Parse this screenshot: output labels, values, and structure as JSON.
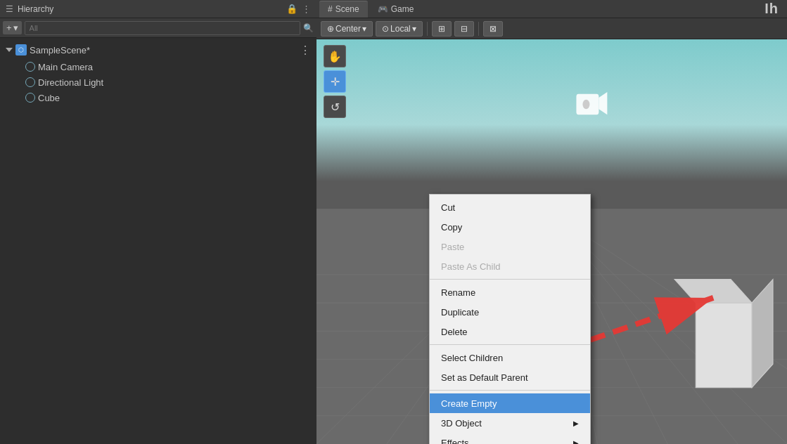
{
  "hierarchy": {
    "title": "Hierarchy",
    "lock_icon": "🔒",
    "menu_icon": "⋮",
    "add_button": "+",
    "add_dropdown": "▾",
    "search_placeholder": "All",
    "scene_name": "SampleScene*",
    "items": [
      {
        "label": "Main Camera",
        "icon": "obj"
      },
      {
        "label": "Directional Light",
        "icon": "obj"
      },
      {
        "label": "Cube",
        "icon": "obj"
      }
    ]
  },
  "tabs": [
    {
      "label": "Scene",
      "icon": "#",
      "active": true
    },
    {
      "label": "Game",
      "icon": "🎮",
      "active": false
    }
  ],
  "toolbar": {
    "center_label": "Center",
    "local_label": "Local",
    "btn1": "⊞",
    "btn2": "⊟",
    "btn3": "⊠"
  },
  "scene_tools": [
    {
      "label": "✋",
      "active": false,
      "name": "hand-tool"
    },
    {
      "label": "✛",
      "active": true,
      "name": "move-tool"
    },
    {
      "label": "↺",
      "active": false,
      "name": "rotate-tool"
    }
  ],
  "context_menu": {
    "items": [
      {
        "label": "Cut",
        "disabled": false,
        "has_arrow": false,
        "highlighted": false
      },
      {
        "label": "Copy",
        "disabled": false,
        "has_arrow": false,
        "highlighted": false
      },
      {
        "label": "Paste",
        "disabled": true,
        "has_arrow": false,
        "highlighted": false
      },
      {
        "label": "Paste As Child",
        "disabled": true,
        "has_arrow": false,
        "highlighted": false
      },
      {
        "separator": true
      },
      {
        "label": "Rename",
        "disabled": false,
        "has_arrow": false,
        "highlighted": false
      },
      {
        "label": "Duplicate",
        "disabled": false,
        "has_arrow": false,
        "highlighted": false
      },
      {
        "label": "Delete",
        "disabled": false,
        "has_arrow": false,
        "highlighted": false
      },
      {
        "separator": true
      },
      {
        "label": "Select Children",
        "disabled": false,
        "has_arrow": false,
        "highlighted": false
      },
      {
        "label": "Set as Default Parent",
        "disabled": false,
        "has_arrow": false,
        "highlighted": false
      },
      {
        "separator": true
      },
      {
        "label": "Create Empty",
        "disabled": false,
        "has_arrow": false,
        "highlighted": true
      },
      {
        "label": "3D Object",
        "disabled": false,
        "has_arrow": true,
        "highlighted": false
      },
      {
        "label": "Effects",
        "disabled": false,
        "has_arrow": true,
        "highlighted": false
      }
    ]
  },
  "accent_color": "#4a90d9",
  "header_label": "Ih"
}
